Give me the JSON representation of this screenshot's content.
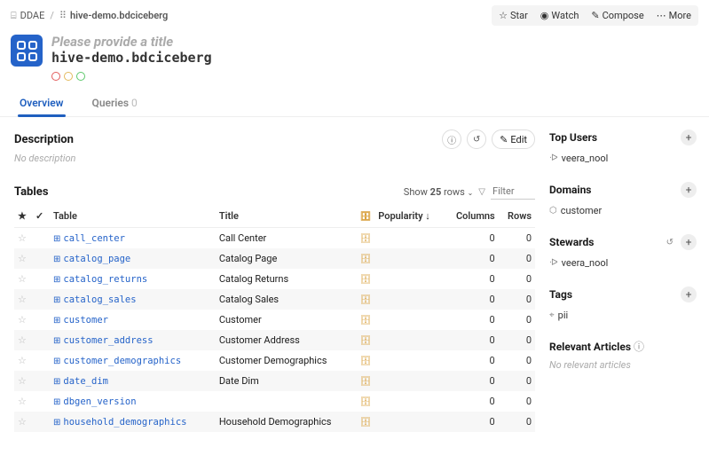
{
  "breadcrumb": {
    "root": "DDAE",
    "current": "hive-demo.bdciceberg"
  },
  "actions": {
    "star": "Star",
    "watch": "Watch",
    "compose": "Compose",
    "more": "More"
  },
  "header": {
    "placeholder": "Please provide a title",
    "name": "hive-demo.bdciceberg"
  },
  "tabs": {
    "overview": "Overview",
    "queries": "Queries",
    "queries_count": "0"
  },
  "desc": {
    "title": "Description",
    "edit": "Edit",
    "empty": "No description"
  },
  "tables": {
    "title": "Tables",
    "show_prefix": "Show",
    "show_count": "25",
    "show_suffix": "rows",
    "filter_placeholder": "Filter",
    "cols": {
      "table": "Table",
      "title": "Title",
      "popularity": "Popularity ↓",
      "columns": "Columns",
      "rows": "Rows"
    },
    "rows": [
      {
        "name": "call_center",
        "title": "Call Center",
        "cols": "0",
        "rows": "0"
      },
      {
        "name": "catalog_page",
        "title": "Catalog Page",
        "cols": "0",
        "rows": "0"
      },
      {
        "name": "catalog_returns",
        "title": "Catalog Returns",
        "cols": "0",
        "rows": "0"
      },
      {
        "name": "catalog_sales",
        "title": "Catalog Sales",
        "cols": "0",
        "rows": "0"
      },
      {
        "name": "customer",
        "title": "Customer",
        "cols": "0",
        "rows": "0"
      },
      {
        "name": "customer_address",
        "title": "Customer Address",
        "cols": "0",
        "rows": "0"
      },
      {
        "name": "customer_demographics",
        "title": "Customer Demographics",
        "cols": "0",
        "rows": "0"
      },
      {
        "name": "date_dim",
        "title": "Date Dim",
        "cols": "0",
        "rows": "0"
      },
      {
        "name": "dbgen_version",
        "title": "",
        "cols": "0",
        "rows": "0"
      },
      {
        "name": "household_demographics",
        "title": "Household Demographics",
        "cols": "0",
        "rows": "0"
      }
    ]
  },
  "side": {
    "top_users": {
      "title": "Top Users",
      "items": [
        "veera_nool"
      ]
    },
    "domains": {
      "title": "Domains",
      "items": [
        "customer"
      ]
    },
    "stewards": {
      "title": "Stewards",
      "items": [
        "veera_nool"
      ]
    },
    "tags": {
      "title": "Tags",
      "items": [
        "pii"
      ]
    },
    "articles": {
      "title": "Relevant Articles",
      "empty": "No relevant articles"
    }
  }
}
